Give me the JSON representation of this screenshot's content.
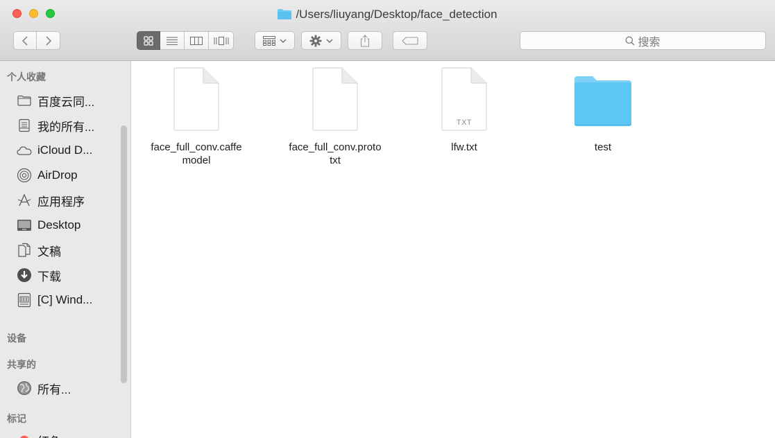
{
  "window": {
    "title": "/Users/liuyang/Desktop/face_detection"
  },
  "toolbar": {
    "search_placeholder": "搜索"
  },
  "sidebar": {
    "favorites_header": "个人收藏",
    "favorites": [
      {
        "label": "百度云同...",
        "icon": "folder-icon"
      },
      {
        "label": "我的所有...",
        "icon": "all-files-icon"
      },
      {
        "label": "iCloud D...",
        "icon": "cloud-icon"
      },
      {
        "label": "AirDrop",
        "icon": "airdrop-icon"
      },
      {
        "label": "应用程序",
        "icon": "applications-icon"
      },
      {
        "label": "Desktop",
        "icon": "desktop-icon"
      },
      {
        "label": "文稿",
        "icon": "documents-icon"
      },
      {
        "label": "下载",
        "icon": "downloads-icon"
      },
      {
        "label": "[C] Wind...",
        "icon": "drive-icon"
      }
    ],
    "devices_header": "设备",
    "shared_header": "共享的",
    "shared": [
      {
        "label": "所有...",
        "icon": "network-icon"
      }
    ],
    "tags_header": "标记",
    "tags": [
      {
        "label": "红色",
        "color": "#fc5f57"
      }
    ]
  },
  "files": [
    {
      "name_line1": "face_full_conv.caffe",
      "name_line2": "model",
      "type": "document"
    },
    {
      "name_line1": "face_full_conv.proto",
      "name_line2": "txt",
      "type": "document"
    },
    {
      "name_line1": "lfw.txt",
      "name_line2": "",
      "type": "text",
      "badge": "TXT"
    },
    {
      "name_line1": "test",
      "name_line2": "",
      "type": "folder",
      "color": "#5ec6f4"
    }
  ]
}
